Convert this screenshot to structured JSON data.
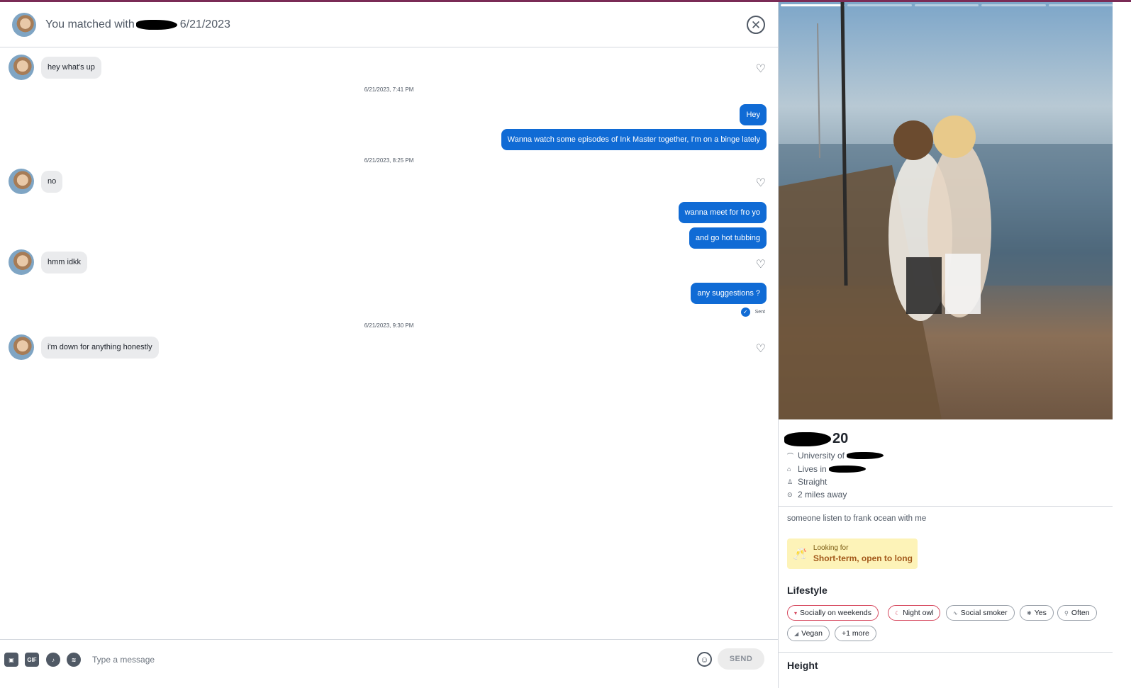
{
  "header": {
    "match_prefix": "You matched with",
    "match_date": "6/21/2023",
    "close_symbol": "✕"
  },
  "messages": {
    "in_1": "hey what's up",
    "time_1": "6/21/2023, 7:41 PM",
    "out_1": "Hey",
    "out_2": "Wanna watch some episodes of Ink Master together, I'm on a binge lately",
    "time_2": "6/21/2023, 8:25 PM",
    "in_2": "no",
    "out_3": "wanna meet for fro yo",
    "out_4": "and go hot tubbing",
    "in_3": "hmm idkk",
    "out_5": "any suggestions ?",
    "status": "Sent",
    "time_3": "6/21/2023, 9:30 PM",
    "in_4": "i'm down for anything honestly"
  },
  "composer": {
    "placeholder": "Type a message",
    "send_label": "SEND",
    "gif_label": "GIF",
    "emoji_symbol": "☺",
    "heart_symbol": "♡",
    "check_symbol": "✓"
  },
  "profile": {
    "age": "20",
    "school_prefix": "University of",
    "lives_prefix": "Lives in",
    "orientation": "Straight",
    "distance": "2 miles away",
    "bio": "someone listen to frank ocean with me",
    "looking_label": "Looking for",
    "looking_value": "Short-term, open to long",
    "lifestyle_title": "Lifestyle",
    "chips": [
      "Socially on weekends",
      "Night owl",
      "Social smoker",
      "Yes",
      "Often",
      "Vegan",
      "+1 more"
    ],
    "height_title": "Height"
  },
  "colors": {
    "accent": "#106bd5",
    "top_bar": "#7a2b56",
    "chip_highlight": "#d6485e",
    "looking_bg": "#fdf3b8"
  },
  "icons": {
    "close": "close-icon",
    "like": "heart-icon",
    "school": "graduation-cap-icon",
    "home": "home-icon",
    "gender": "person-icon",
    "location": "location-pin-icon",
    "looking": "champagne-icon"
  }
}
